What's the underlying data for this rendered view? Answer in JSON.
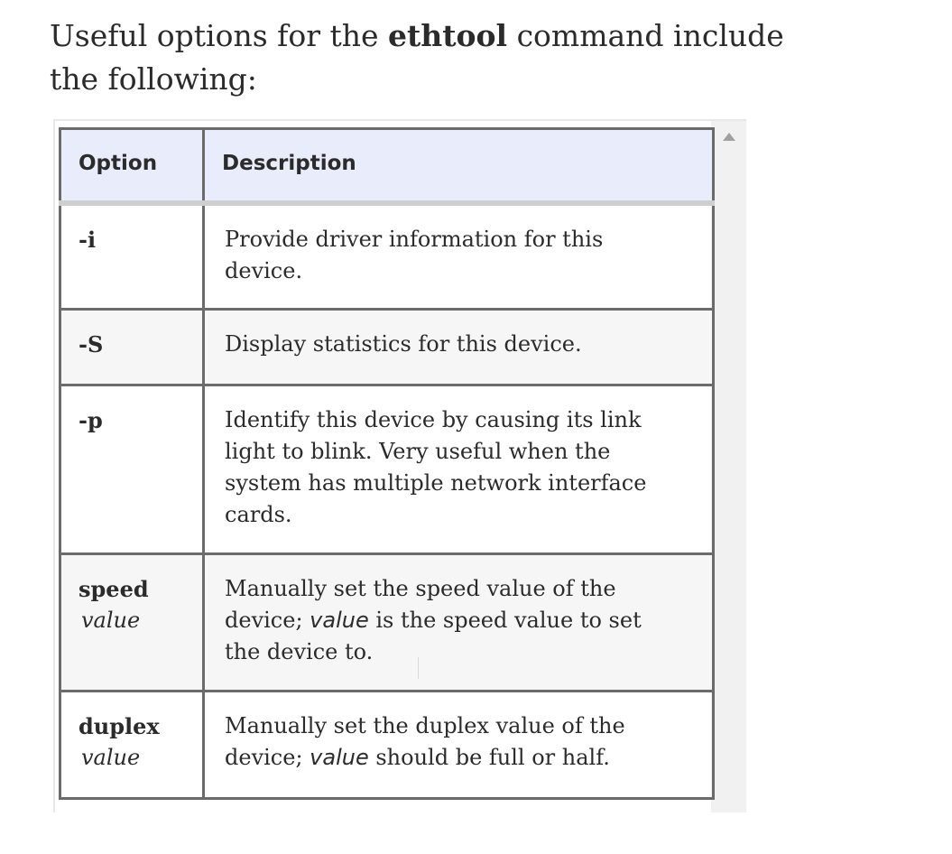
{
  "intro": {
    "before": "Useful options for the ",
    "command": "ethtool",
    "after": " command include the following:"
  },
  "table": {
    "headers": [
      "Option",
      "Description"
    ],
    "rows": [
      {
        "option": "-i",
        "arg": "",
        "desc_lines": [
          "Provide driver information for this",
          "device."
        ]
      },
      {
        "option": "-S",
        "arg": "",
        "desc_lines": [
          "Display statistics for this device."
        ]
      },
      {
        "option": "-p",
        "arg": "",
        "desc_lines": [
          "Identify this device by causing its link",
          "light to blink. Very useful when the",
          "system has multiple network interface",
          "cards."
        ]
      },
      {
        "option": "speed",
        "arg": "value",
        "desc": {
          "l1": "Manually set the speed value of the",
          "l2a": "device; ",
          "l2em": "value",
          "l2b": " is the speed value to set",
          "l3": "the device to."
        }
      },
      {
        "option": "duplex",
        "arg": "value",
        "desc": {
          "l1": "Manually set the duplex value of the",
          "l2a": "device; ",
          "l2em": "value",
          "l2b": " should be full or half."
        }
      }
    ]
  }
}
